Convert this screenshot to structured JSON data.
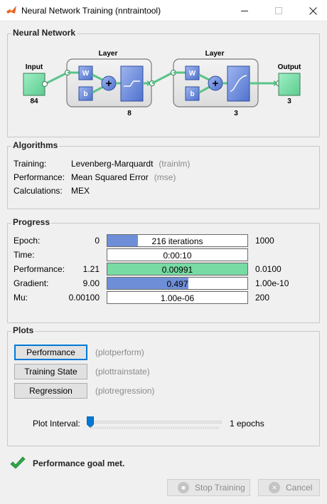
{
  "window": {
    "title": "Neural Network Training (nntraintool)"
  },
  "network": {
    "panel_title": "Neural Network",
    "input_label": "Input",
    "input_size": "84",
    "layer1_label": "Layer",
    "layer1_size": "8",
    "layer2_label": "Layer",
    "layer2_size": "3",
    "output_label": "Output",
    "output_size": "3",
    "weight_symbol": "W",
    "bias_symbol": "b",
    "sum_symbol": "+"
  },
  "algorithms": {
    "panel_title": "Algorithms",
    "rows": [
      {
        "label": "Training:",
        "value": "Levenberg-Marquardt",
        "code": "(trainlm)"
      },
      {
        "label": "Performance:",
        "value": "Mean Squared Error",
        "code": "(mse)"
      },
      {
        "label": "Calculations:",
        "value": "MEX",
        "code": ""
      }
    ]
  },
  "progress": {
    "panel_title": "Progress",
    "rows": [
      {
        "label": "Epoch:",
        "min": "0",
        "text": "216 iterations",
        "max": "1000",
        "fill_fraction": 0.216,
        "fill_color": "#6e8fd8"
      },
      {
        "label": "Time:",
        "min": "",
        "text": "0:00:10",
        "max": "",
        "fill_fraction": 0,
        "fill_color": "#6e8fd8"
      },
      {
        "label": "Performance:",
        "min": "1.21",
        "text": "0.00991",
        "max": "0.0100",
        "fill_fraction": 1.0,
        "fill_color": "#77dba3"
      },
      {
        "label": "Gradient:",
        "min": "9.00",
        "text": "0.497",
        "max": "1.00e-10",
        "fill_fraction": 0.58,
        "fill_color": "#6e8fd8"
      },
      {
        "label": "Mu:",
        "min": "0.00100",
        "text": "1.00e-06",
        "max": "200",
        "fill_fraction": 0,
        "fill_color": "#6e8fd8"
      }
    ]
  },
  "plots": {
    "panel_title": "Plots",
    "buttons": [
      {
        "label": "Performance",
        "code": "(plotperform)"
      },
      {
        "label": "Training State",
        "code": "(plottrainstate)"
      },
      {
        "label": "Regression",
        "code": "(plotregression)"
      }
    ],
    "interval_label": "Plot Interval:",
    "interval_value": "1 epochs",
    "interval_fraction": 0.0
  },
  "status": {
    "message": "Performance goal met."
  },
  "footer": {
    "stop_label": "Stop Training",
    "cancel_label": "Cancel"
  },
  "colors": {
    "weight_blue": "#6e8fd8",
    "green_box": "#77dba3",
    "panel_border": "#c8c8c8"
  }
}
